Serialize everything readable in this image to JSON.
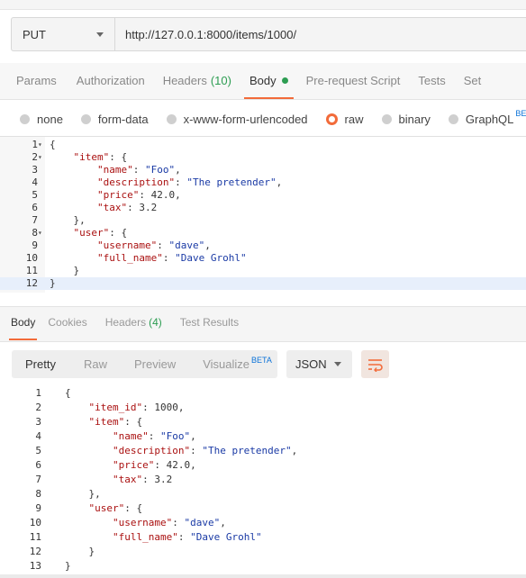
{
  "request": {
    "method": "PUT",
    "url": "http://127.0.0.1:8000/items/1000/"
  },
  "request_tabs": [
    {
      "label": "Params"
    },
    {
      "label": "Authorization"
    },
    {
      "label": "Headers",
      "count": "(10)"
    },
    {
      "label": "Body",
      "active": true
    },
    {
      "label": "Pre-request Script"
    },
    {
      "label": "Tests"
    },
    {
      "label": "Set"
    }
  ],
  "body_types": [
    {
      "label": "none"
    },
    {
      "label": "form-data"
    },
    {
      "label": "x-www-form-urlencoded"
    },
    {
      "label": "raw",
      "selected": true
    },
    {
      "label": "binary"
    },
    {
      "label": "GraphQL",
      "badge": "BETA"
    }
  ],
  "editor": {
    "lines": [
      [
        "1",
        "{"
      ],
      [
        "2",
        "    \"item\": {"
      ],
      [
        "3",
        "        \"name\": \"Foo\","
      ],
      [
        "4",
        "        \"description\": \"The pretender\","
      ],
      [
        "5",
        "        \"price\": 42.0,"
      ],
      [
        "6",
        "        \"tax\": 3.2"
      ],
      [
        "7",
        "    },"
      ],
      [
        "8",
        "    \"user\": {"
      ],
      [
        "9",
        "        \"username\": \"dave\","
      ],
      [
        "10",
        "        \"full_name\": \"Dave Grohl\""
      ],
      [
        "11",
        "    }"
      ],
      [
        "12",
        "}"
      ]
    ],
    "current_line": "12"
  },
  "response_tabs": [
    {
      "label": "Body",
      "active": true
    },
    {
      "label": "Cookies"
    },
    {
      "label": "Headers",
      "count": "(4)"
    },
    {
      "label": "Test Results"
    }
  ],
  "view_modes": {
    "pretty": "Pretty",
    "raw": "Raw",
    "preview": "Preview",
    "visualize": "Visualize",
    "visualize_badge": "BETA"
  },
  "format": "JSON",
  "response": {
    "lines": [
      [
        "1",
        "{"
      ],
      [
        "2",
        "    \"item_id\": 1000,"
      ],
      [
        "3",
        "    \"item\": {"
      ],
      [
        "4",
        "        \"name\": \"Foo\","
      ],
      [
        "5",
        "        \"description\": \"The pretender\","
      ],
      [
        "6",
        "        \"price\": 42.0,"
      ],
      [
        "7",
        "        \"tax\": 3.2"
      ],
      [
        "8",
        "    },"
      ],
      [
        "9",
        "    \"user\": {"
      ],
      [
        "10",
        "        \"username\": \"dave\","
      ],
      [
        "11",
        "        \"full_name\": \"Dave Grohl\""
      ],
      [
        "12",
        "    }"
      ],
      [
        "13",
        "}"
      ]
    ]
  },
  "colors": {
    "accent": "#f26b3a",
    "green": "#2d9d52",
    "key": "#a11111",
    "string": "#1a3aa5",
    "beta": "#0c73d8"
  }
}
